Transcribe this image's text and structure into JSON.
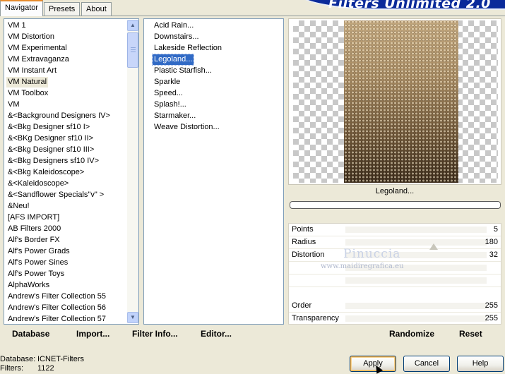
{
  "tabs": [
    "Navigator",
    "Presets",
    "About"
  ],
  "banner": "Filters Unlimited 2.0",
  "categories": {
    "items": [
      "VM 1",
      "VM Distortion",
      "VM Experimental",
      "VM Extravaganza",
      "VM Instant Art",
      "VM Natural",
      "VM Toolbox",
      "VM",
      "&<Background Designers IV>",
      "&<Bkg Designer sf10 I>",
      "&<BKg Designer sf10 II>",
      "&<Bkg Designer sf10 III>",
      "&<Bkg Designers sf10 IV>",
      "&<Bkg Kaleidoscope>",
      "&<Kaleidoscope>",
      "&<Sandflower Specials\"v\" >",
      "&Neu!",
      "[AFS IMPORT]",
      "AB Filters 2000",
      "Alf's Border FX",
      "Alf's Power Grads",
      "Alf's Power Sines",
      "Alf's Power Toys",
      "AlphaWorks",
      "Andrew's Filter Collection 55",
      "Andrew's Filter Collection 56",
      "Andrew's Filter Collection 57"
    ],
    "selected": "VM Natural"
  },
  "filters": {
    "items": [
      "Acid Rain...",
      "Downstairs...",
      "Lakeside Reflection",
      "Legoland...",
      "Plastic Starfish...",
      "Sparkle",
      "Speed...",
      "Splash!...",
      "Starmaker...",
      "Weave Distortion..."
    ],
    "selected": "Legoland..."
  },
  "preview": {
    "label": "Legoland..."
  },
  "params": [
    {
      "name": "Points",
      "value": "5"
    },
    {
      "name": "Radius",
      "value": "180"
    },
    {
      "name": "Distortion",
      "value": "32"
    },
    {
      "name": "",
      "value": ""
    },
    {
      "name": "",
      "value": ""
    },
    {
      "name": "Order",
      "value": "255"
    },
    {
      "name": "Transparency",
      "value": "255"
    }
  ],
  "watermark": {
    "line1": "Pinuccia",
    "line2": "www.maidiregrafica.eu"
  },
  "links": {
    "database": "Database",
    "import": "Import...",
    "filter_info": "Filter Info...",
    "editor": "Editor...",
    "randomize": "Randomize",
    "reset": "Reset"
  },
  "status": {
    "database_label": "Database:",
    "database_value": "ICNET-Filters",
    "filters_label": "Filters:",
    "filters_value": "1122"
  },
  "buttons": {
    "apply": "Apply",
    "cancel": "Cancel",
    "help": "Help"
  },
  "colors": {
    "selection": "#316AC5",
    "banner": "#0A2A9A",
    "tab_accent": "#E68B2C"
  }
}
